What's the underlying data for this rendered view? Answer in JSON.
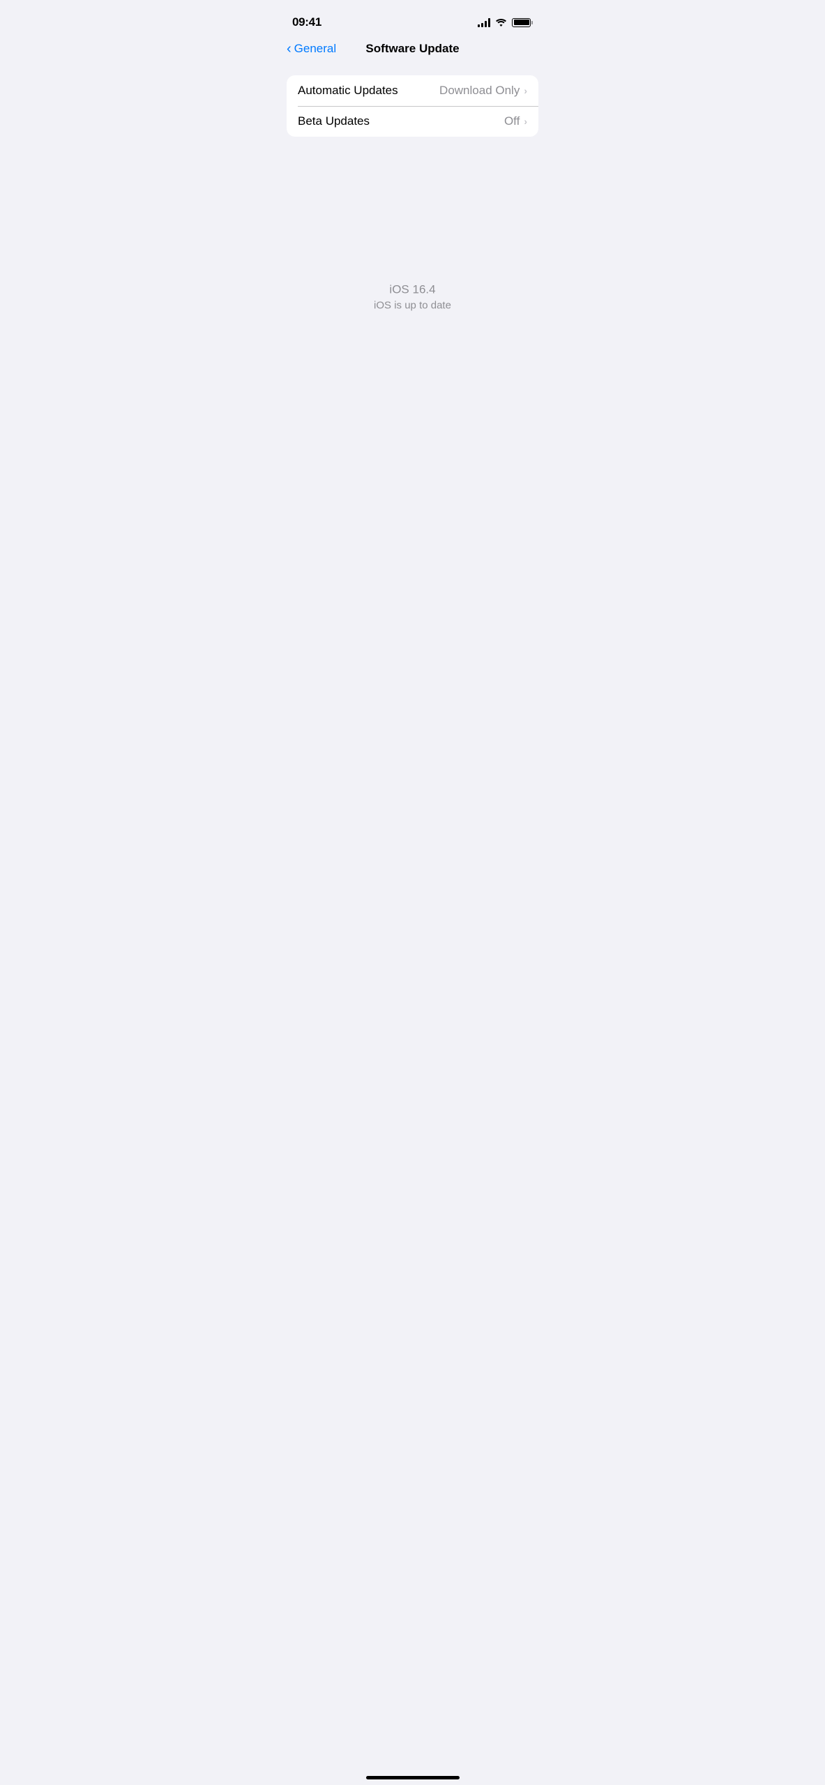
{
  "statusBar": {
    "time": "09:41",
    "signalBars": 4,
    "battery": "full"
  },
  "navBar": {
    "backLabel": "General",
    "title": "Software Update"
  },
  "settingsGroups": [
    {
      "items": [
        {
          "label": "Automatic Updates",
          "value": "Download Only",
          "hasChevron": true
        },
        {
          "label": "Beta Updates",
          "value": "Off",
          "hasChevron": true
        }
      ]
    }
  ],
  "centerStatus": {
    "version": "iOS 16.4",
    "status": "iOS is up to date"
  },
  "homeIndicator": true
}
